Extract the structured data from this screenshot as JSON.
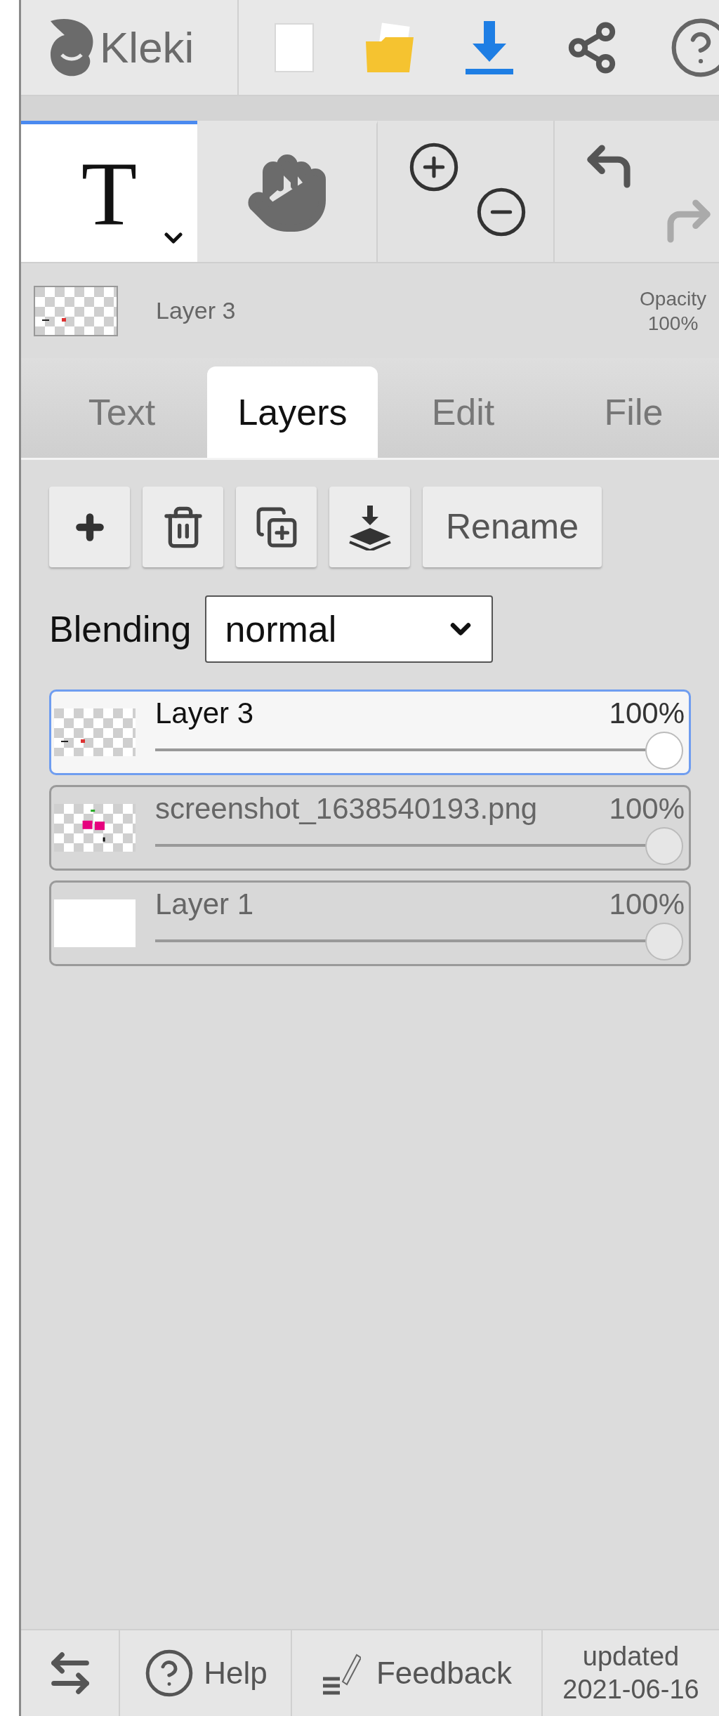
{
  "toolbar": {
    "logo": "Kleki"
  },
  "tools": [
    {
      "kind": "text",
      "label": "T",
      "selected": true
    },
    {
      "kind": "hand",
      "selected": false
    }
  ],
  "layer_info": {
    "name": "Layer 3",
    "opacity_label": "Opacity",
    "opacity": "100%"
  },
  "tabs": [
    {
      "label": "Text",
      "selected": false
    },
    {
      "label": "Layers",
      "selected": true
    },
    {
      "label": "Edit",
      "selected": false
    },
    {
      "label": "File",
      "selected": false
    }
  ],
  "layer_actions": {
    "rename": "Rename"
  },
  "blending": {
    "label": "Blending",
    "value": "normal"
  },
  "layers": [
    {
      "kind": "sketch",
      "name": "Layer 3",
      "opacity": "100%",
      "level": 1,
      "selected": true
    },
    {
      "kind": "image",
      "name": "screenshot_1638540193.png",
      "opacity": "100%",
      "level": 1,
      "selected": false
    },
    {
      "kind": "blank",
      "name": "Layer 1",
      "opacity": "100%",
      "level": 1,
      "selected": false
    }
  ],
  "footer": {
    "help": "Help",
    "feedback": "Feedback",
    "updated": "updated",
    "date": "2021-06-16"
  }
}
